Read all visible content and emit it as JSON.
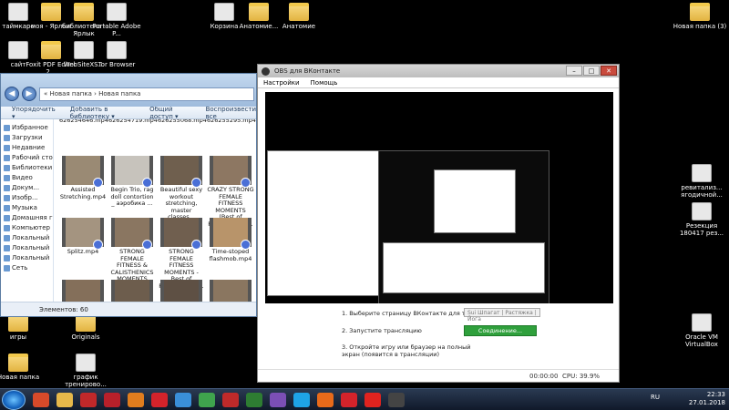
{
  "desktop": {
    "icons_left": [
      {
        "label": "таймкаро"
      },
      {
        "label": "моя - Ярлык"
      },
      {
        "label": "библиотека - Ярлык"
      },
      {
        "label": "Portable Adobe P..."
      },
      {
        "label": "сайт"
      },
      {
        "label": "Foxit PDF Editor 2..."
      },
      {
        "label": "WebSiteXS..."
      },
      {
        "label": "Tor Browser"
      }
    ],
    "icons_top": [
      {
        "label": "Корзина"
      },
      {
        "label": "Анатомие..."
      },
      {
        "label": "Анатомие"
      }
    ],
    "icons_right": [
      {
        "label": "Новая папка (3)"
      },
      {
        "label": "ревитализ... ягодичной..."
      },
      {
        "label": "Резекция 180417 рез..."
      },
      {
        "label": "Oracle VM VirtualBox"
      }
    ],
    "icons_bottom_left": [
      {
        "label": "игры"
      },
      {
        "label": "Originals"
      },
      {
        "label": "Новая папка"
      },
      {
        "label": "график тренирово..."
      }
    ]
  },
  "explorer": {
    "address": "« Новая папка › Новая папка",
    "toolbar": [
      "Упорядочить ▾",
      "Добавить в библиотеку ▾",
      "Общий доступ ▾",
      "Воспроизвести все"
    ],
    "nav_items": [
      "Избранное",
      "Загрузки",
      "Недавние",
      "Рабочий стол",
      "Библиотеки",
      "Видео",
      "Докум...",
      "Изобр...",
      "Музыка",
      "Домашняя группа",
      "Компьютер",
      "Локальный",
      "Локальный",
      "Локальный",
      "Сеть"
    ],
    "files": [
      {
        "name": "626254646.mp4",
        "thumb_color": "#7a6a55"
      },
      {
        "name": "626254719.mp4",
        "thumb_color": "#8e7b63"
      },
      {
        "name": "626255068.mp4",
        "thumb_color": "#6b5c4c"
      },
      {
        "name": "626255295.mp4",
        "thumb_color": "#7f6f5d"
      },
      {
        "name": "Assisted Stretching.mp4",
        "thumb_color": "#9a8a74"
      },
      {
        "name": "Begin Trio, rag doll contortion _ аэробика ...",
        "thumb_color": "#c7c3bc"
      },
      {
        "name": "Beautiful sexy workout stretching, master classes...",
        "thumb_color": "#6f5f4e"
      },
      {
        "name": "CRAZY STRONG FEMALE FITNESS MOMENTS (Best of February 201...",
        "thumb_color": "#8d7762"
      },
      {
        "name": "Splitz.mp4",
        "thumb_color": "#a49480"
      },
      {
        "name": "STRONG FEMALE FITNESS & CALISTHENICS MOMENTS 201...",
        "thumb_color": "#8a7661"
      },
      {
        "name": "STRONG FEMALE FITNESS MOMENTS - Best of February 201...",
        "thumb_color": "#705f4f"
      },
      {
        "name": "Time-stoped flashmob.mp4",
        "thumb_color": "#b8946a"
      },
      {
        "name": "",
        "thumb_color": "#846f5a"
      },
      {
        "name": "",
        "thumb_color": "#6d5d4d"
      },
      {
        "name": "",
        "thumb_color": "#5e5044"
      },
      {
        "name": "",
        "thumb_color": "#8a7660"
      }
    ],
    "status": "Элементов: 60"
  },
  "obs": {
    "title": "OBS для ВКонтакте",
    "menu": [
      "Настройки",
      "Помощь"
    ],
    "window_controls": [
      "–",
      "□",
      "✕"
    ],
    "step1": "1. Выберите страницу ВКонтакте для трансляции",
    "step1_value": "Sui Шпагат | Растяжка | Йога",
    "step2": "2. Запустите трансляцию",
    "step2_button": "Соединение...",
    "step3": "3. Откройте игру или браузер на полный экран (появится в трансляции)",
    "time": "00:00:00",
    "cpu": "CPU: 39.9%"
  },
  "taskbar": {
    "apps": [
      {
        "name": "ccleaner-icon",
        "color": "#d84a2a"
      },
      {
        "name": "explorer-icon",
        "color": "#e6b84a"
      },
      {
        "name": "app-red-icon",
        "color": "#c0282a"
      },
      {
        "name": "app-red2-icon",
        "color": "#b8202a"
      },
      {
        "name": "app-orange-icon",
        "color": "#e07d1e"
      },
      {
        "name": "opera-icon",
        "color": "#d4232b"
      },
      {
        "name": "ie-icon",
        "color": "#3a8fd8"
      },
      {
        "name": "chrome-icon",
        "color": "#3fa34d"
      },
      {
        "name": "filezilla-icon",
        "color": "#bf2a2a"
      },
      {
        "name": "excel-icon",
        "color": "#2e7d32"
      },
      {
        "name": "app-purple-icon",
        "color": "#7b4fb5"
      },
      {
        "name": "skype-icon",
        "color": "#1ea3e6"
      },
      {
        "name": "firefox-icon",
        "color": "#e86a1a"
      },
      {
        "name": "opera2-icon",
        "color": "#d4232b"
      },
      {
        "name": "yandex-icon",
        "color": "#e0231f"
      },
      {
        "name": "obs-icon",
        "color": "#444444"
      }
    ],
    "lang": "RU",
    "time": "22:33",
    "date": "27.01.2018"
  }
}
